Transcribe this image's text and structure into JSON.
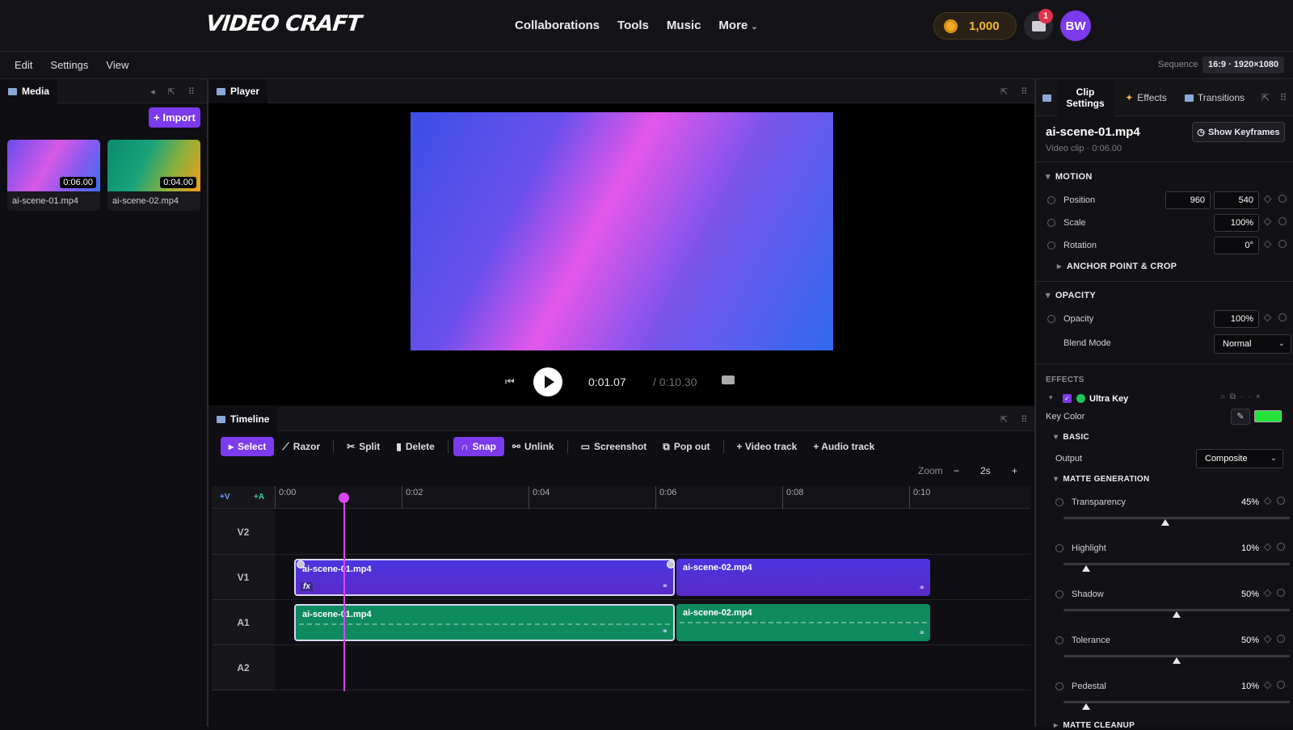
{
  "brand": {
    "logo": "VIDEO CRAFT"
  },
  "nav": {
    "items": [
      "Collaborations",
      "Tools",
      "Music",
      "More"
    ],
    "coins": "1,000",
    "notif_count": "1",
    "avatar": "BW"
  },
  "menubar": {
    "items": [
      "Edit",
      "Settings",
      "View"
    ],
    "sequence_label": "Sequence",
    "sequence_value": "16:9 · 1920×1080"
  },
  "media": {
    "tab": "Media",
    "import_label": "+ Import",
    "items": [
      {
        "name": "ai-scene-01.mp4",
        "duration": "0:06.00"
      },
      {
        "name": "ai-scene-02.mp4",
        "duration": "0:04.00"
      }
    ]
  },
  "player": {
    "tab": "Player",
    "current_time": "0:01.07",
    "total_time": "/ 0:10.30"
  },
  "timeline": {
    "tab": "Timeline",
    "tools": [
      "Select",
      "Razor",
      "Split",
      "Delete",
      "Snap",
      "Unlink",
      "Screenshot",
      "Pop out",
      "+ Video track",
      "+ Audio track"
    ],
    "zoom_label": "Zoom",
    "zoom_minus": "−",
    "zoom_value": "2s",
    "zoom_plus": "+",
    "add_v": "+V",
    "add_a": "+A",
    "ruler": [
      "0:00",
      "0:02",
      "0:04",
      "0:06",
      "0:08",
      "0:10"
    ],
    "tracks": [
      "V2",
      "V1",
      "A1",
      "A2"
    ],
    "clips": {
      "v1a": "ai-scene-01.mp4",
      "v1b": "ai-scene-02.mp4",
      "a1a": "ai-scene-01.mp4",
      "a1b": "ai-scene-02.mp4",
      "fx": "fx"
    },
    "playhead_time": "0:01.07"
  },
  "inspector": {
    "tabs": [
      "Clip Settings",
      "Effects",
      "Transitions"
    ],
    "clip_title": "ai-scene-01.mp4",
    "clip_sub": "Video clip · 0:06.00",
    "keyframes_btn": "Show Keyframes",
    "motion": {
      "title": "MOTION",
      "position_label": "Position",
      "pos_x": "960",
      "pos_y": "540",
      "scale_label": "Scale",
      "scale": "100%",
      "rotation_label": "Rotation",
      "rotation": "0°",
      "anchor": "ANCHOR POINT & CROP"
    },
    "opacity": {
      "title": "OPACITY",
      "opacity_label": "Opacity",
      "opacity": "100%",
      "blend_label": "Blend Mode",
      "blend": "Normal"
    },
    "effects": {
      "title": "EFFECTS",
      "effect_name": "Ultra Key",
      "key_color_label": "Key Color",
      "key_color": "#22e23a",
      "basic": "BASIC",
      "output_label": "Output",
      "output": "Composite",
      "matte": "MATTE GENERATION",
      "sliders": [
        {
          "label": "Transparency",
          "value": "45%",
          "level": 0.45
        },
        {
          "label": "Highlight",
          "value": "10%",
          "level": 0.1
        },
        {
          "label": "Shadow",
          "value": "50%",
          "level": 0.5
        },
        {
          "label": "Tolerance",
          "value": "50%",
          "level": 0.5
        },
        {
          "label": "Pedestal",
          "value": "10%",
          "level": 0.1
        }
      ],
      "next_section": "MATTE CLEANUP"
    }
  },
  "colors": {
    "accent": "#7c3aed",
    "playhead": "#d946ef",
    "video_clip": "#5b2fd6",
    "audio_clip": "#0f8a5f",
    "coin": "#f5b53a"
  }
}
